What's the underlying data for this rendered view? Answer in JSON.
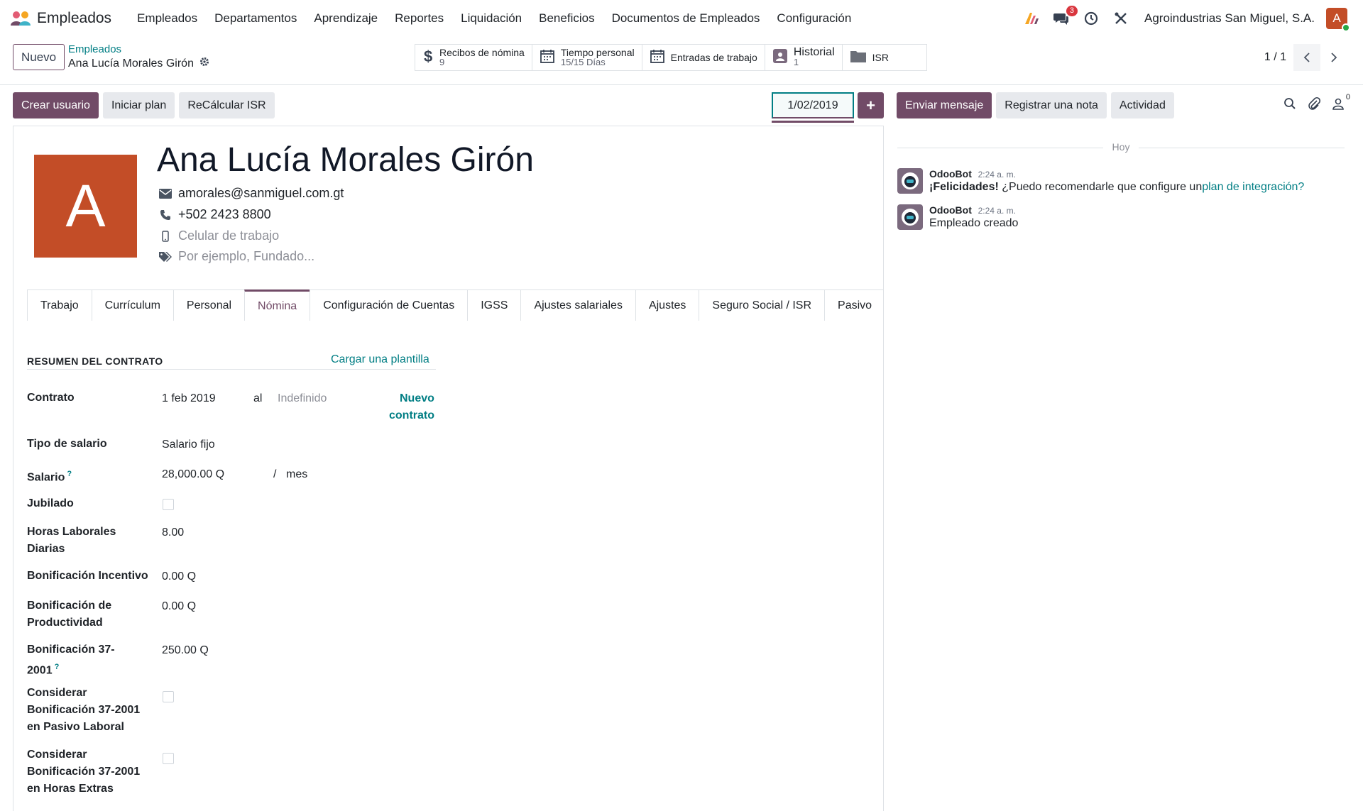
{
  "topnav": {
    "app_name": "Empleados",
    "menu": [
      "Empleados",
      "Departamentos",
      "Aprendizaje",
      "Reportes",
      "Liquidación",
      "Beneficios",
      "Documentos de Empleados",
      "Configuración"
    ],
    "messages_badge": "3",
    "company": "Agroindustrias San Miguel, S.A.",
    "user_initial": "A"
  },
  "control": {
    "new_label": "Nuevo",
    "breadcrumb_parent": "Empleados",
    "breadcrumb_current": "Ana Lucía Morales Girón",
    "smart_buttons": [
      {
        "label": "Recibos de nómina",
        "value": "9",
        "icon": "dollar-icon"
      },
      {
        "label": "Tiempo personal",
        "value": "15/15 Días",
        "icon": "calendar-icon"
      },
      {
        "label": "Entradas de trabajo",
        "value": "",
        "icon": "calendar-icon"
      },
      {
        "label": "Historial",
        "value": "1",
        "icon": "contact-card-icon"
      },
      {
        "label": "ISR",
        "value": "",
        "icon": "folder-icon"
      }
    ],
    "pager": "1 / 1"
  },
  "actions": {
    "create_user": "Crear usuario",
    "start_plan": "Iniciar plan",
    "recalc": "ReCálcular ISR",
    "date": "1/02/2019",
    "plus": "+"
  },
  "employee": {
    "initial": "A",
    "name": "Ana Lucía Morales Girón",
    "email": "amorales@sanmiguel.com.gt",
    "phone": "+502 2423 8800",
    "mobile_placeholder": "Celular de trabajo",
    "tags_placeholder": "Por ejemplo, Fundado..."
  },
  "tabs": [
    "Trabajo",
    "Currículum",
    "Personal",
    "Nómina",
    "Configuración de Cuentas",
    "IGSS",
    "Ajustes salariales",
    "Ajustes",
    "Seguro Social / ISR",
    "Pasivo"
  ],
  "active_tab": "Nómina",
  "contract": {
    "section_title": "RESUMEN DEL CONTRATO",
    "load_template": "Cargar una plantilla",
    "contract_label": "Contrato",
    "contract_start": "1 feb 2019",
    "contract_to": "al",
    "contract_end_placeholder": "Indefinido",
    "new_contract_1": "Nuevo",
    "new_contract_2": "contrato",
    "salary_type_label": "Tipo de salario",
    "salary_type": "Salario fijo",
    "salary_label": "Salario",
    "help_mark": "?",
    "salary": "28,000.00 Q",
    "salary_sep": "/",
    "salary_period": "mes",
    "retired_label": "Jubilado",
    "retired": false,
    "hours_label_1": "Horas Laborales",
    "hours_label_2": "Diarias",
    "hours": "8.00",
    "incentive_label": "Bonificación Incentivo",
    "incentive": "0.00 Q",
    "productivity_label_1": "Bonificación de",
    "productivity_label_2": "Productividad",
    "productivity": "0.00 Q",
    "bonus37_label_1": "Bonificación 37-",
    "bonus37_label_2": "2001",
    "bonus37": "250.00 Q",
    "consider_liab_1": "Considerar",
    "consider_liab_2": "Bonificación 37-2001",
    "consider_liab_3": "en Pasivo Laboral",
    "consider_liab": false,
    "consider_ot_1": "Considerar",
    "consider_ot_2": "Bonificación 37-2001",
    "consider_ot_3": "en Horas Extras",
    "consider_ot": false
  },
  "chatter": {
    "send_message": "Enviar mensaje",
    "log_note": "Registrar una nota",
    "activity": "Actividad",
    "followers_count": "0",
    "today": "Hoy",
    "messages": [
      {
        "author": "OdooBot",
        "time": "2:24 a. m.",
        "bold": "¡Felicidades!",
        "text": " ¿Puedo recomendarle que configure un",
        "link": "plan de integración?"
      },
      {
        "author": "OdooBot",
        "time": "2:24 a. m.",
        "text": "Empleado creado"
      }
    ]
  },
  "colors": {
    "primary": "#714b67",
    "accent": "#017e84",
    "avatar": "#c34d27",
    "badge": "#d9363e"
  }
}
